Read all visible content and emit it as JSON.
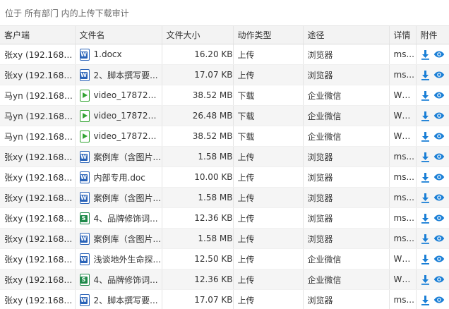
{
  "breadcrumb": "位于 所有部门 内的上传下载审计",
  "columns": [
    "客户端",
    "文件名",
    "文件大小",
    "动作类型",
    "途径",
    "详情",
    "附件"
  ],
  "rows": [
    {
      "client": "张xy (192.168.3...",
      "icon": "word",
      "file": "1.docx",
      "size": "16.20 KB",
      "action": "上传",
      "channel": "浏览器",
      "detail": "ms..."
    },
    {
      "client": "张xy (192.168.3...",
      "icon": "word",
      "file": "2、脚本撰写要...",
      "size": "17.07 KB",
      "action": "上传",
      "channel": "浏览器",
      "detail": "ms..."
    },
    {
      "client": "马yn (192.168.3...",
      "icon": "video",
      "file": "video_1787297...",
      "size": "38.52 MB",
      "action": "下载",
      "channel": "企业微信",
      "detail": "WX..."
    },
    {
      "client": "马yn (192.168.3...",
      "icon": "video",
      "file": "video_1787297...",
      "size": "26.48 MB",
      "action": "下载",
      "channel": "企业微信",
      "detail": "WX..."
    },
    {
      "client": "马yn (192.168.3...",
      "icon": "video",
      "file": "video_1787297...",
      "size": "38.52 MB",
      "action": "下载",
      "channel": "企业微信",
      "detail": "WX..."
    },
    {
      "client": "张xy (192.168.3...",
      "icon": "word",
      "file": "案例库（含图片...",
      "size": "1.58 MB",
      "action": "上传",
      "channel": "浏览器",
      "detail": "ms..."
    },
    {
      "client": "张xy (192.168.3...",
      "icon": "word",
      "file": "内部专用.doc",
      "size": "10.00 KB",
      "action": "上传",
      "channel": "浏览器",
      "detail": "ms..."
    },
    {
      "client": "张xy (192.168.3...",
      "icon": "word",
      "file": "案例库（含图片...",
      "size": "1.58 MB",
      "action": "上传",
      "channel": "浏览器",
      "detail": "ms..."
    },
    {
      "client": "张xy (192.168.3...",
      "icon": "excel",
      "file": "4、品牌修饰词...",
      "size": "12.36 KB",
      "action": "上传",
      "channel": "浏览器",
      "detail": "ms..."
    },
    {
      "client": "张xy (192.168.3...",
      "icon": "word",
      "file": "案例库（含图片...",
      "size": "1.58 MB",
      "action": "上传",
      "channel": "浏览器",
      "detail": "ms..."
    },
    {
      "client": "张xy (192.168.3...",
      "icon": "word",
      "file": "浅谈地外生命探...",
      "size": "12.50 KB",
      "action": "上传",
      "channel": "企业微信",
      "detail": "WX..."
    },
    {
      "client": "张xy (192.168.3...",
      "icon": "excel",
      "file": "4、品牌修饰词...",
      "size": "12.36 KB",
      "action": "上传",
      "channel": "企业微信",
      "detail": "WX..."
    },
    {
      "client": "张xy (192.168.3...",
      "icon": "word",
      "file": "2、脚本撰写要...",
      "size": "17.07 KB",
      "action": "上传",
      "channel": "浏览器",
      "detail": "ms..."
    }
  ],
  "colors": {
    "accent": "#1a7fd6",
    "header_bg": "#f3f3f3",
    "stripe_bg": "#f5f5f5"
  },
  "icons": {
    "word": "word-file-icon",
    "video": "video-file-icon",
    "excel": "excel-file-icon",
    "download": "download-icon",
    "preview": "eye-icon"
  }
}
